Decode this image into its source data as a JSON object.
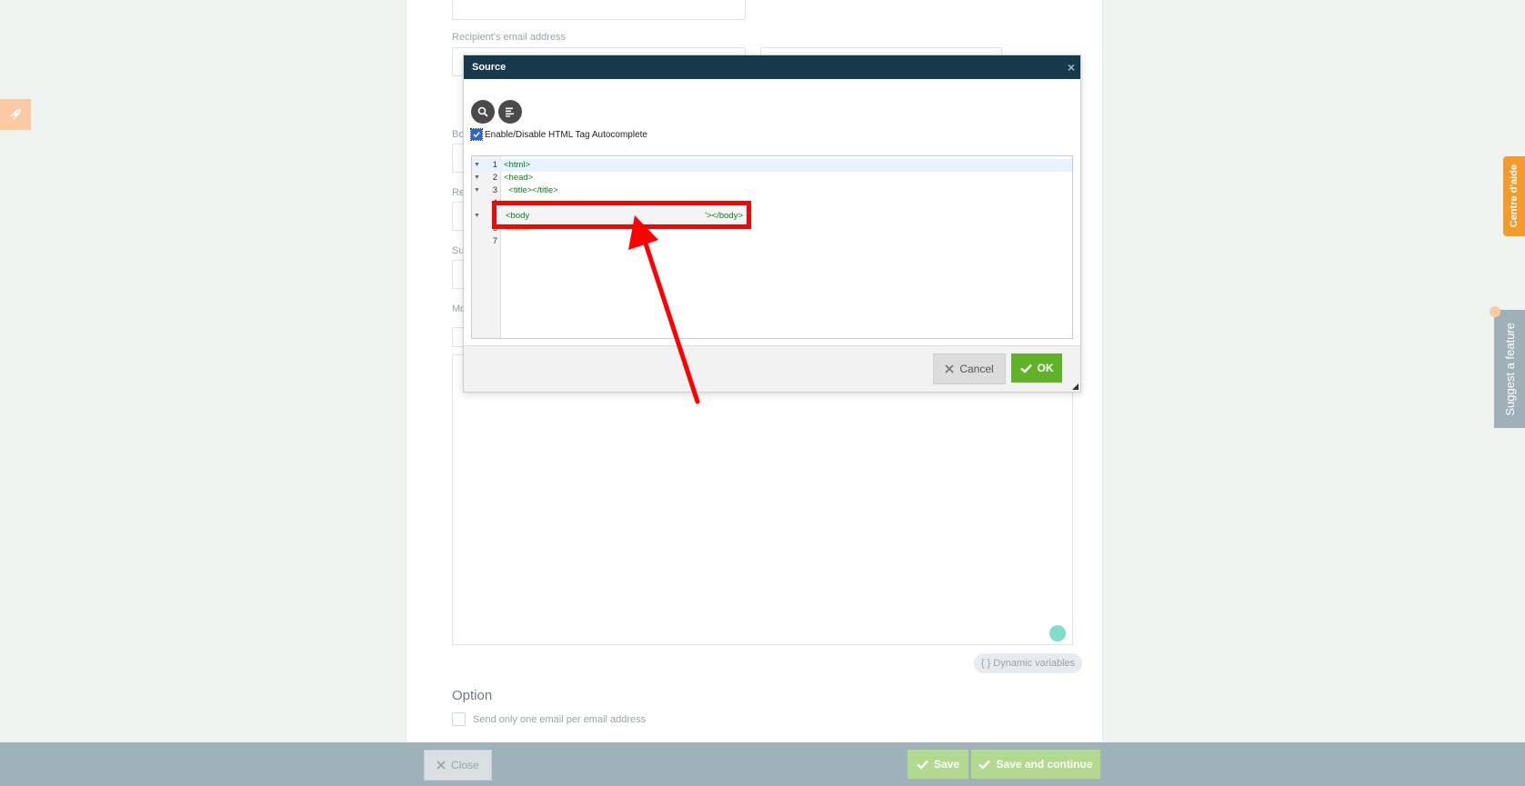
{
  "form": {
    "recipient_email_label": "Recipient's email address",
    "partial_labels": [
      "Bo",
      "Re",
      "Su",
      "Mo"
    ]
  },
  "dialog": {
    "title": "Source",
    "close_glyph": "×",
    "autocomplete_label": "Enable/Disable HTML Tag Autocomplete",
    "lines": [
      {
        "n": "1",
        "code": "<html>"
      },
      {
        "n": "2",
        "code": "<head>"
      },
      {
        "n": "3",
        "code": "  <title></title>"
      },
      {
        "n": "4",
        "code": ""
      },
      {
        "n": "5",
        "code": ""
      },
      {
        "n": "6",
        "code": "</html>"
      },
      {
        "n": "7",
        "code": ""
      }
    ],
    "highlight_left": "<body",
    "highlight_right": "'></body>",
    "cancel_label": "Cancel",
    "ok_label": "OK"
  },
  "side": {
    "help_label": "Centre d'aide",
    "suggest_label": "Suggest a feature"
  },
  "editor_area": {
    "dynamic_variables_label": "{ } Dynamic variables"
  },
  "option": {
    "title": "Option",
    "checkbox_label": "Send only one email per email address"
  },
  "bottom": {
    "close_label": "Close",
    "save_label": "Save",
    "save_continue_label": "Save and continue"
  },
  "colors": {
    "dialog_header": "#16394b",
    "ok_green": "#62b229",
    "annotation_red": "#ff0000",
    "help_orange": "#f59a2d"
  }
}
